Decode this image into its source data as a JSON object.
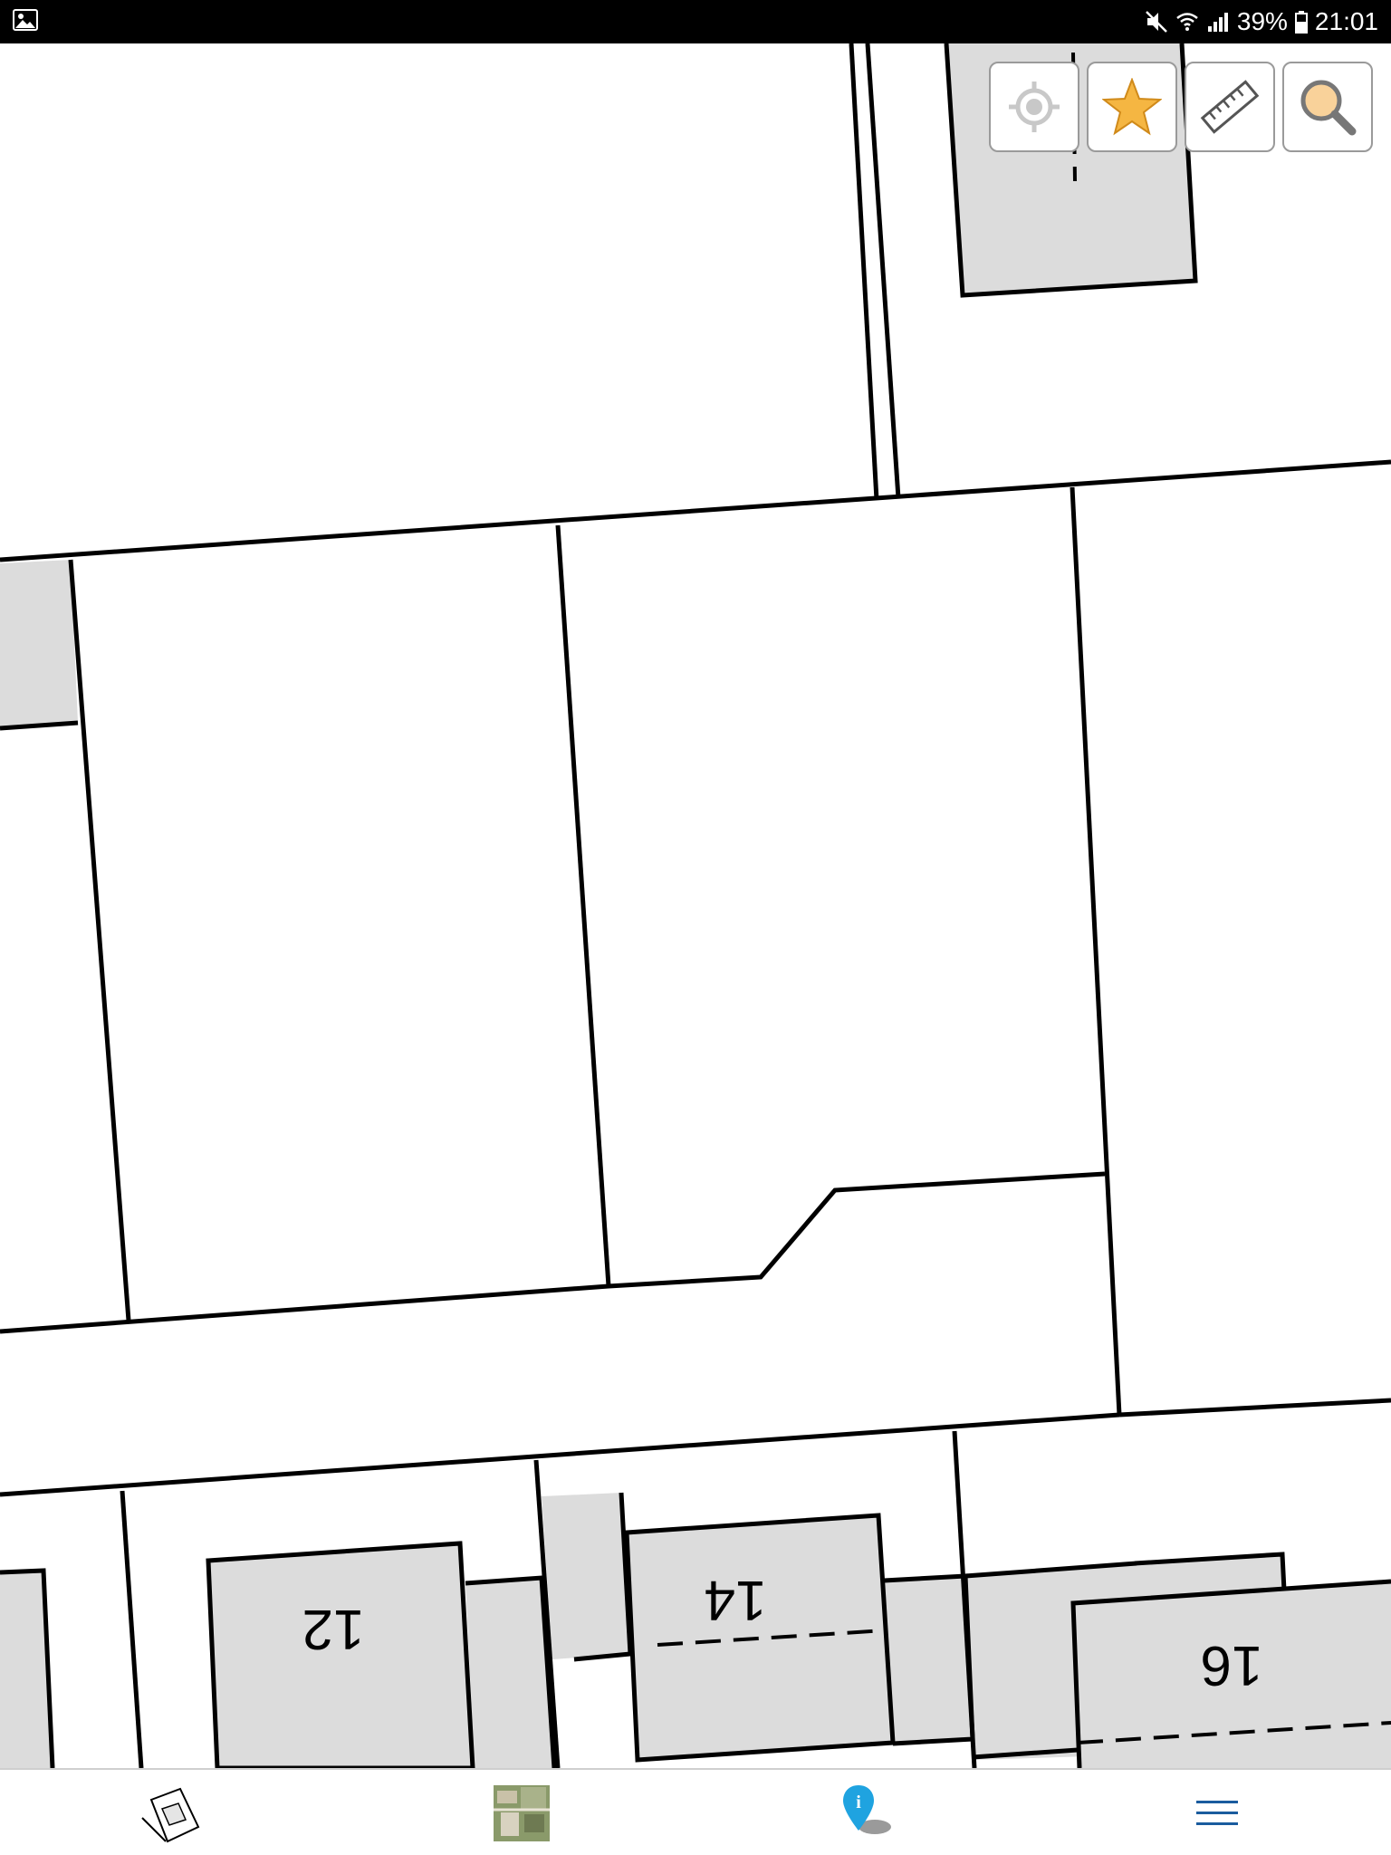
{
  "status_bar": {
    "battery_percent": "39%",
    "time": "21:01",
    "icons": [
      "gallery-notification-icon",
      "mute-icon",
      "wifi-icon",
      "signal-icon",
      "battery-icon"
    ]
  },
  "map": {
    "house_numbers": [
      "12",
      "14",
      "16"
    ],
    "colors": {
      "building_fill": "#dcdcdc",
      "parcel_line": "#000000",
      "background": "#ffffff"
    }
  },
  "map_tools": [
    {
      "name": "locate-button",
      "icon": "crosshair-icon"
    },
    {
      "name": "favorites-button",
      "icon": "star-icon"
    },
    {
      "name": "measure-button",
      "icon": "ruler-icon"
    },
    {
      "name": "search-button",
      "icon": "magnifier-icon"
    }
  ],
  "bottom_nav": [
    {
      "name": "nav-cadastral-map",
      "icon": "cadastral-map-thumbnail-icon"
    },
    {
      "name": "nav-aerial-photo",
      "icon": "aerial-photo-thumbnail-icon"
    },
    {
      "name": "nav-info",
      "icon": "info-pin-icon"
    },
    {
      "name": "nav-menu",
      "icon": "hamburger-menu-icon"
    }
  ],
  "accent_colors": {
    "star": "#f5b642",
    "info_pin": "#1fa3e0",
    "menu": "#1a5c9e"
  }
}
